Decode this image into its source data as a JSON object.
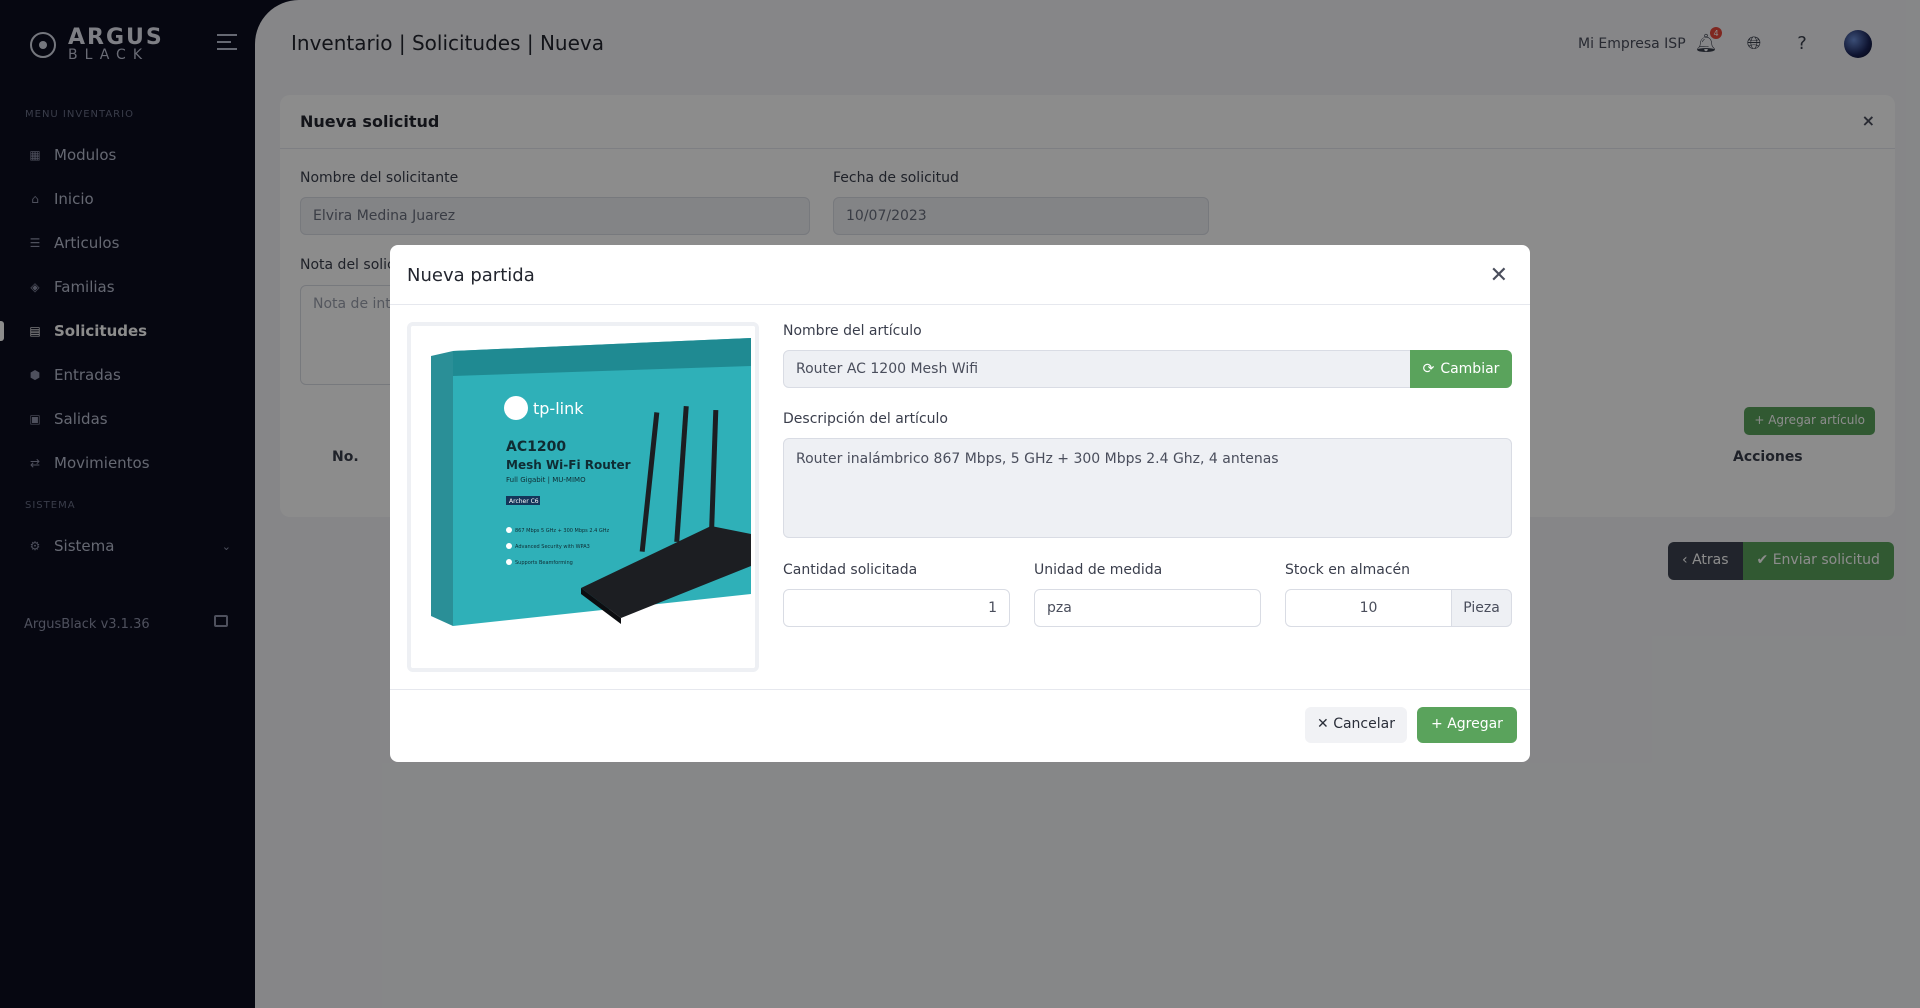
{
  "brand": {
    "line1": "ARGUS",
    "line2": "BLACK"
  },
  "sidebar": {
    "section_inventory": "MENU INVENTARIO",
    "section_system": "SISTEMA",
    "items": [
      {
        "label": "Modulos",
        "icon": "grid-icon"
      },
      {
        "label": "Inicio",
        "icon": "home-icon"
      },
      {
        "label": "Articulos",
        "icon": "list-icon"
      },
      {
        "label": "Familias",
        "icon": "layers-icon"
      },
      {
        "label": "Solicitudes",
        "icon": "document-icon",
        "active": true
      },
      {
        "label": "Entradas",
        "icon": "box-in-icon"
      },
      {
        "label": "Salidas",
        "icon": "box-out-icon"
      },
      {
        "label": "Movimientos",
        "icon": "transfer-icon"
      }
    ],
    "system_item": "Sistema",
    "version": "ArgusBlack v3.1.36"
  },
  "header": {
    "title": "Inventario | Solicitudes | Nueva",
    "company": "Mi Empresa ISP",
    "notifications": "4"
  },
  "card": {
    "title": "Nueva solicitud",
    "requester_label": "Nombre del solicitante",
    "requester_value": "Elvira Medina Juarez",
    "date_label": "Fecha de solicitud",
    "date_value": "10/07/2023",
    "note_label": "Nota del solic",
    "note_placeholder": "Nota de int",
    "add_article": "Agregar artículo",
    "col_no": "No.",
    "col_actions": "Acciones",
    "back": "Atras",
    "send": "Enviar solicitud"
  },
  "modal": {
    "title": "Nueva partida",
    "name_label": "Nombre del artículo",
    "name_value": "Router AC 1200 Mesh Wifi",
    "change_btn": "Cambiar",
    "desc_label": "Descripción del artículo",
    "desc_value": "Router inalámbrico 867 Mbps, 5 GHz + 300 Mbps 2.4 Ghz, 4 antenas",
    "qty_label": "Cantidad solicitada",
    "qty_value": "1",
    "unit_label": "Unidad de medida",
    "unit_value": "pza",
    "stock_label": "Stock en almacén",
    "stock_value": "10",
    "stock_unit": "Pieza",
    "cancel_btn": "Cancelar",
    "add_btn": "Agregar",
    "product_image": {
      "brand": "tp-link",
      "model": "AC1200",
      "name": "Mesh Wi-Fi Router",
      "line": "Full Gigabit | MU-MIMO",
      "sku": "Archer C6",
      "bullets": [
        "867 Mbps 5 GHz + 300 Mbps 2.4 GHz",
        "Advanced Security with WPA3",
        "Supports Beamforming"
      ]
    }
  },
  "colors": {
    "primary_green": "#5aa35c",
    "sidebar_bg": "#0b0d1f",
    "badge_red": "#e8473b"
  }
}
